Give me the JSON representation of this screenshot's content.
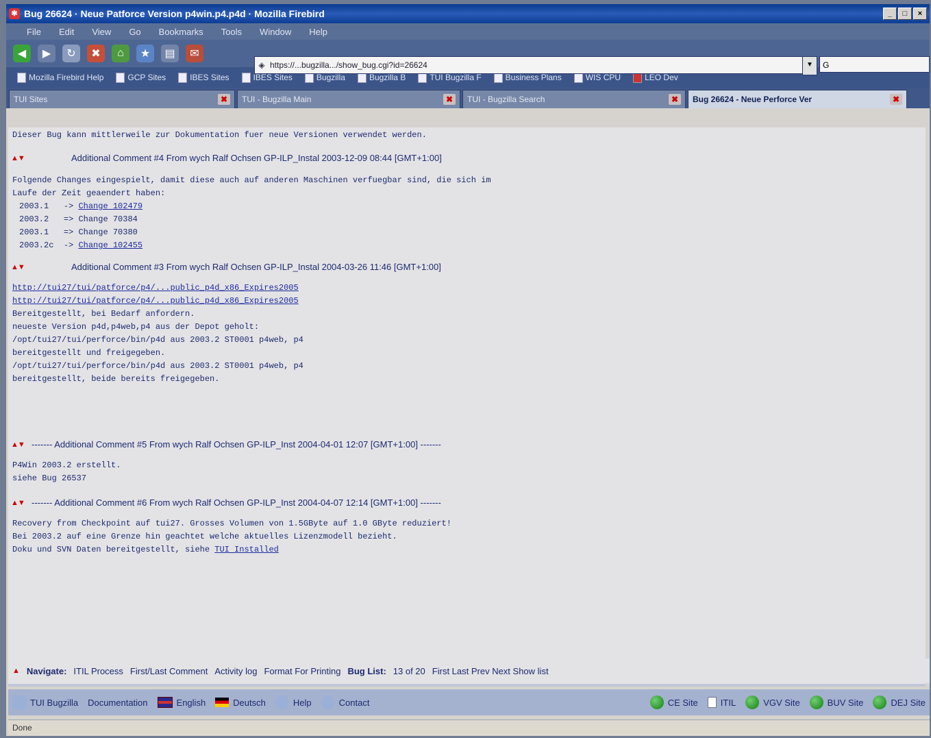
{
  "window": {
    "title": "Bug 26624 · Neue Patforce Version p4win.p4.p4d · Mozilla Firebird",
    "icon": "bug-icon",
    "controls": [
      "_",
      "□",
      "×"
    ]
  },
  "menu": [
    "File",
    "Edit",
    "View",
    "Go",
    "Bookmarks",
    "Tools",
    "Window",
    "Help"
  ],
  "toolbar": {
    "url": "https://...bugzilla.../show_bug.cgi?id=26624",
    "search_placeholder": "G"
  },
  "bookmarks": [
    "Mozilla Firebird Help",
    "GCP Sites",
    "IBES Sites",
    "IBES Sites",
    "Bugzilla",
    "Bugzilla B",
    "TUI Bugzilla F",
    "Business Plans",
    "WIS CPU",
    "LEO Dev"
  ],
  "tabs": [
    {
      "label": "TUI Sites"
    },
    {
      "label": "TUI - Bugzilla Main"
    },
    {
      "label": "TUI - Bugzilla Search"
    },
    {
      "label": "Bug 26624 - Neue Perforce Ver"
    }
  ],
  "content": {
    "top_line": "Dieser Bug kann mittlerweile zur Dokumentation fuer neue Versionen verwendet werden.",
    "comments": [
      {
        "header": "Additional Comment #4 From   wych    Ralf Ochsen    GP-ILP_Instal 2003-12-09 08:44 [GMT+1:00]",
        "lines": [
          "Folgende Changes eingespielt, damit diese auch auf anderen Maschinen verfuegbar sind, die sich im",
          "Laufe der Zeit geaendert haben:"
        ],
        "changes": [
          {
            "ver": "2003.1",
            "arrow": "->",
            "label": "Change 102479"
          },
          {
            "ver": "2003.2",
            "arrow": "=>",
            "label": "Change 70384"
          },
          {
            "ver": "2003.1",
            "arrow": "=>",
            "label": "Change 70380"
          },
          {
            "ver": "2003.2c",
            "arrow": "->",
            "label": "Change 102455"
          }
        ]
      },
      {
        "header": "Additional Comment #3 From   wych    Ralf Ochsen    GP-ILP_Instal 2004-03-26 11:46 [GMT+1:00]",
        "links": [
          "http://tui27/tui/patforce/p4/...public_p4d_x86_Expires2005",
          "http://tui27/tui/patforce/p4/...public_p4d_x86_Expires2005"
        ],
        "lines": [
          "Bereitgestellt, bei Bedarf anfordern.",
          "",
          "neueste Version p4d,p4web,p4 aus der Depot geholt:",
          "/opt/tui27/tui/perforce/bin/p4d aus 2003.2 ST0001 p4web, p4",
          "bereitgestellt und freigegeben.",
          "",
          "/opt/tui27/tui/perforce/bin/p4d aus 2003.2 ST0001 p4web, p4",
          "bereitgestellt, beide bereits freigegeben."
        ]
      },
      {
        "header": "------- Additional Comment #5 From   wych    Ralf Ochsen    GP-ILP_Inst 2004-04-01 12:07 [GMT+1:00] -------",
        "lines": [
          "P4Win 2003.2 erstellt.",
          "siehe Bug 26537"
        ]
      },
      {
        "header": "------- Additional Comment #6 From   wych    Ralf Ochsen    GP-ILP_Inst 2004-04-07 12:14 [GMT+1:00] -------",
        "lines": [
          "Recovery from Checkpoint auf tui27. Grosses Volumen von 1.5GByte auf 1.0 GByte reduziert!",
          "Bei 2003.2 auf eine Grenze hin geachtet welche aktuelles Lizenzmodell bezieht.",
          "Doku und SVN Daten bereitgestellt, siehe"
        ],
        "tail_link": "TUI Installed"
      }
    ]
  },
  "navigation": {
    "label": "Navigate:",
    "items": [
      "ITIL Process",
      "First/Last Comment",
      "Activity log",
      "Format For Printing"
    ],
    "buglist_label": "Bug List:",
    "buglist_items": [
      "13 of 20",
      "First Last Prev Next Show list"
    ]
  },
  "footer": {
    "items": [
      {
        "label": "TUI Bugzilla",
        "icon": "bugzilla-icon"
      },
      {
        "label": "Documentation",
        "icon": "none"
      },
      {
        "label": "English",
        "icon": "english-flag-icon"
      },
      {
        "label": "Deutsch",
        "icon": "german-flag-icon"
      },
      {
        "label": "Help",
        "icon": "help-icon"
      },
      {
        "label": "Contact",
        "icon": "contact-icon"
      }
    ],
    "sites": [
      "CE Site",
      "ITIL",
      "VGV Site",
      "BUV Site",
      "DEJ Site"
    ]
  },
  "status": {
    "text": "Done"
  }
}
